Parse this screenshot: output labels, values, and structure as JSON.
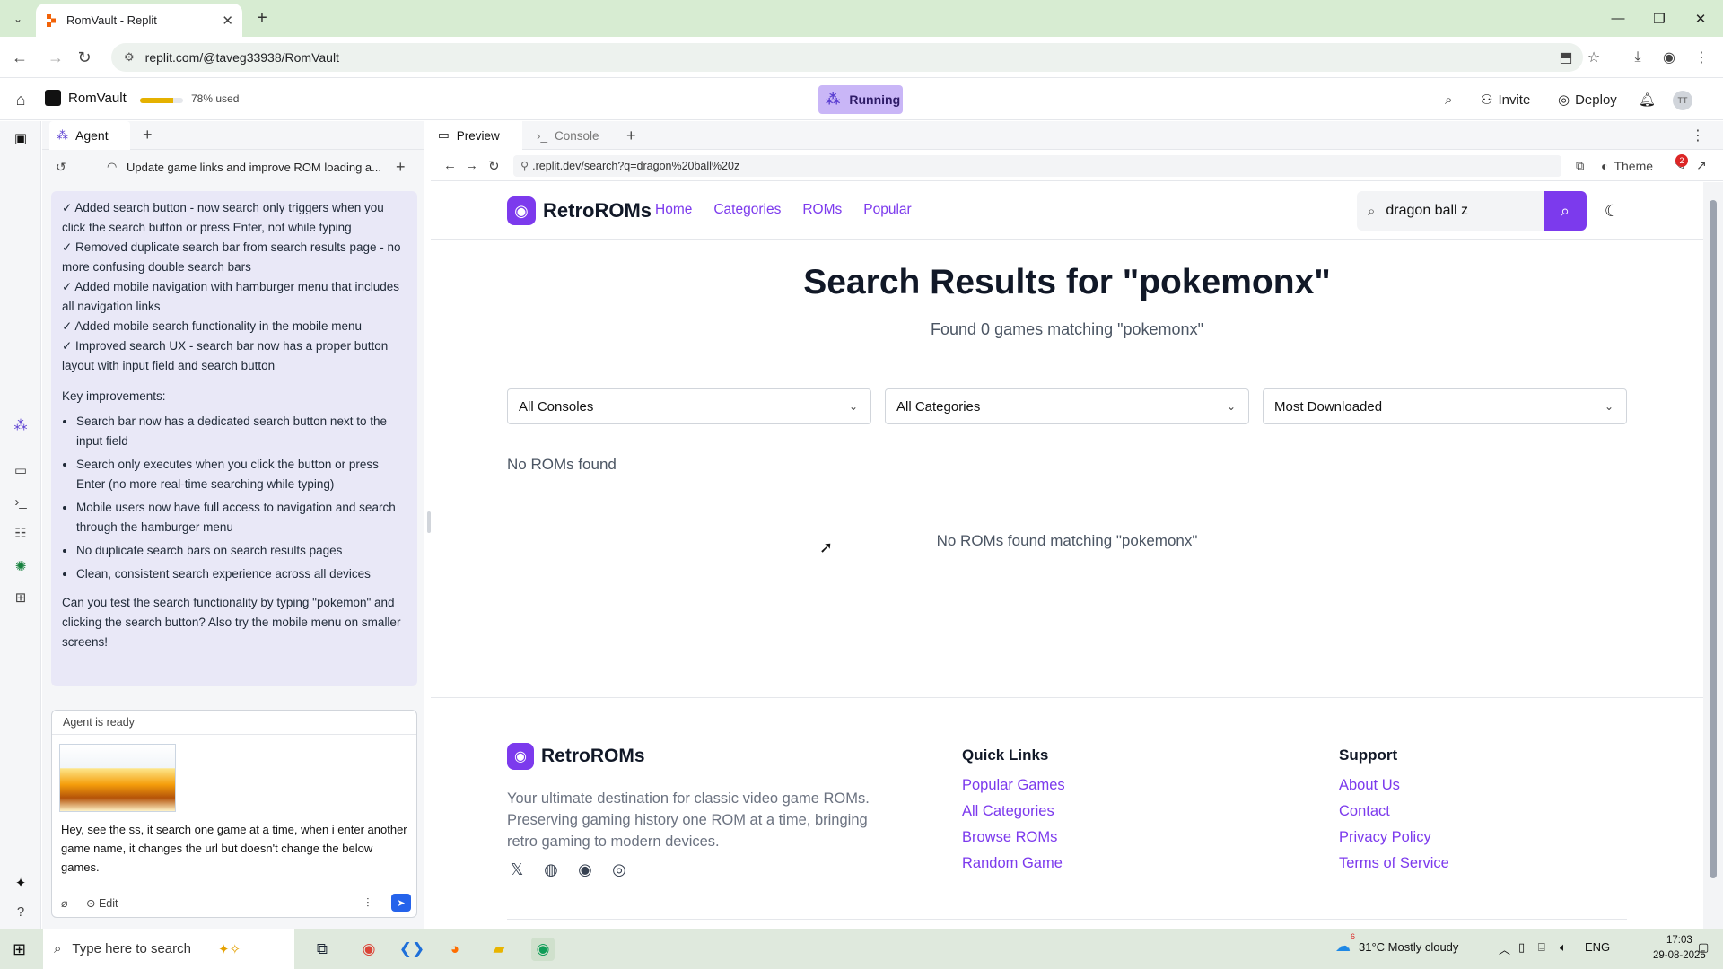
{
  "browser": {
    "tab_title": "RomVault - Replit",
    "url": "replit.com/@taveg33938/RomVault"
  },
  "replit": {
    "project_name": "RomVault",
    "usage_fraction": 0.78,
    "usage_text": "78% used",
    "status": "Running",
    "invite_label": "Invite",
    "deploy_label": "Deploy",
    "avatar_initials": "TT",
    "accent_color": "#7c3aed"
  },
  "agent": {
    "tab_label": "Agent",
    "thread_title": "Update game links and improve ROM loading a...",
    "message_lines": [
      "✓ Added search button - now search only triggers when you click the search button or press Enter, not while typing",
      "✓ Removed duplicate search bar from search results page - no more confusing double search bars",
      "✓ Added mobile navigation with hamburger menu that includes all navigation links",
      "✓ Added mobile search functionality in the mobile menu",
      "✓ Improved search UX - search bar now has a proper button layout with input field and search button"
    ],
    "improvements_heading": "Key improvements:",
    "improvements": [
      "Search bar now has a dedicated search button next to the input field",
      "Search only executes when you click the button or press Enter (no more real-time searching while typing)",
      "Mobile users now have full access to navigation and search through the hamburger menu",
      "No duplicate search bars on search results pages",
      "Clean, consistent search experience across all devices"
    ],
    "closing": "Can you test the search functionality by typing \"pokemon\" and clicking the search button? Also try the mobile menu on smaller screens!",
    "input_status": "Agent is ready",
    "input_text": "Hey, see the ss, it search one game at a time, when i enter another game name, it changes the url but doesn't change the below games.",
    "edit_label": "Edit"
  },
  "preview": {
    "tab_preview": "Preview",
    "tab_console": "Console",
    "url": ".replit.dev/search?q=dragon%20ball%20z",
    "theme_label": "Theme",
    "badge_count": "2"
  },
  "site": {
    "brand": "RetroROMs",
    "nav": [
      "Home",
      "Categories",
      "ROMs",
      "Popular"
    ],
    "search_value": "dragon ball z",
    "results_title": "Search Results for \"pokemonx\"",
    "results_sub": "Found 0 games matching \"pokemonx\"",
    "filters": [
      "All Consoles",
      "All Categories",
      "Most Downloaded"
    ],
    "no_roms": "No ROMs found",
    "no_roms_match": "No ROMs found matching \"pokemonx\"",
    "footer": {
      "brand": "RetroROMs",
      "description": "Your ultimate destination for classic video game ROMs. Preserving gaming history one ROM at a time, bringing retro gaming to modern devices.",
      "quick_links_heading": "Quick Links",
      "quick_links": [
        "Popular Games",
        "All Categories",
        "Browse ROMs",
        "Random Game"
      ],
      "support_heading": "Support",
      "support_links": [
        "About Us",
        "Contact",
        "Privacy Policy",
        "Terms of Service"
      ]
    }
  },
  "taskbar": {
    "search_placeholder": "Type here to search",
    "weather": "31°C  Mostly cloudy",
    "weather_badge": "6",
    "language": "ENG",
    "time": "17:03",
    "date": "29-08-2025"
  }
}
